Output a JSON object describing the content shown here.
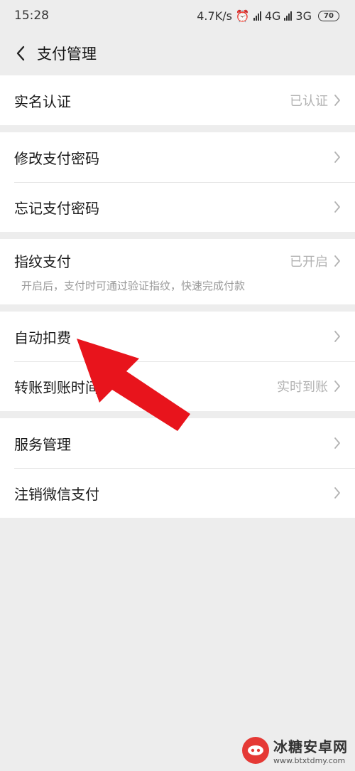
{
  "status": {
    "time": "15:28",
    "speed": "4.7K/s",
    "network1": "4G",
    "network2": "3G",
    "battery": "70"
  },
  "header": {
    "title": "支付管理"
  },
  "groups": [
    {
      "rows": [
        {
          "label": "实名认证",
          "value": "已认证"
        }
      ]
    },
    {
      "rows": [
        {
          "label": "修改支付密码"
        },
        {
          "label": "忘记支付密码"
        }
      ]
    },
    {
      "rows": [
        {
          "label": "指纹支付",
          "value": "已开启",
          "sub": "开启后，支付时可通过验证指纹，快速完成付款"
        }
      ]
    },
    {
      "rows": [
        {
          "label": "自动扣费"
        },
        {
          "label": "转账到账时间",
          "value": "实时到账"
        }
      ]
    },
    {
      "rows": [
        {
          "label": "服务管理"
        },
        {
          "label": "注销微信支付"
        }
      ]
    }
  ],
  "watermark": {
    "name": "冰糖安卓网",
    "url": "www.btxtdmy.com"
  },
  "colors": {
    "annotation_arrow": "#e8141c",
    "background": "#ededed"
  }
}
